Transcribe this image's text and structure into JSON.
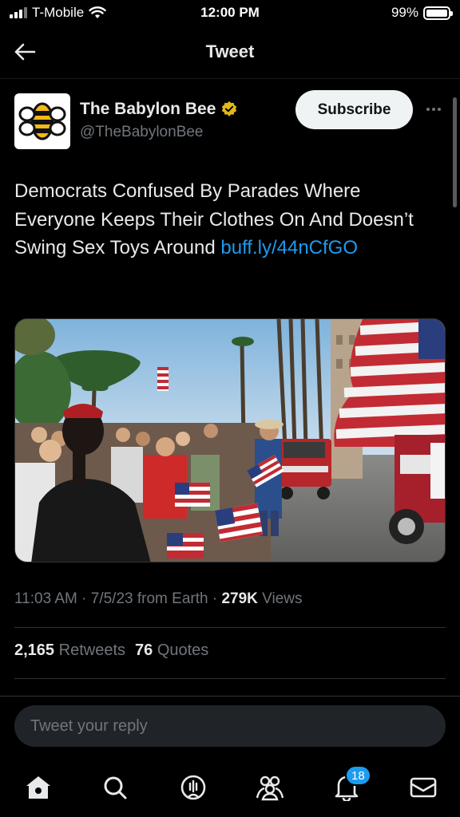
{
  "status": {
    "carrier": "T-Mobile",
    "time": "12:00 PM",
    "battery": "99%",
    "battery_level": 0.99
  },
  "nav": {
    "title": "Tweet"
  },
  "author": {
    "name": "The Babylon Bee",
    "handle": "@TheBabylonBee",
    "subscribe_label": "Subscribe",
    "verified_color": "#e2b719"
  },
  "tweet": {
    "text": "Democrats Confused By Parades Where Everyone Keeps Their Clothes On And Doesn’t Swing Sex Toys Around ",
    "link": "buff.ly/​44nCfGO"
  },
  "meta": {
    "time": "11:03 AM",
    "date": "7/5/23",
    "source": "from Earth",
    "views_count": "279K",
    "views_label": "Views"
  },
  "stats": {
    "retweets_count": "2,165",
    "retweets_label": "Retweets",
    "quotes_count": "76",
    "quotes_label": "Quotes"
  },
  "reply": {
    "placeholder": "Tweet your reply"
  },
  "tabs": {
    "items": [
      "home-icon",
      "search-icon",
      "spaces-icon",
      "communities-icon",
      "notifications-icon",
      "messages-icon"
    ],
    "notifications_badge": "18"
  },
  "colors": {
    "background": "#000000",
    "accent": "#1d9bf0",
    "text": "#e7e9ea",
    "muted": "#71767b"
  }
}
